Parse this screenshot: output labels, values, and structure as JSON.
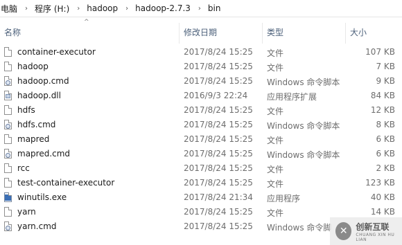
{
  "breadcrumb": [
    "电脑",
    "程序 (H:)",
    "hadoop",
    "hadoop-2.7.3",
    "bin"
  ],
  "columns": {
    "name": "名称",
    "modified": "修改日期",
    "type": "类型",
    "size": "大小"
  },
  "files": [
    {
      "name": "container-executor",
      "date": "2017/8/24 15:25",
      "type": "文件",
      "size": "107 KB",
      "icon": "file-icon"
    },
    {
      "name": "hadoop",
      "date": "2017/8/24 15:25",
      "type": "文件",
      "size": "7 KB",
      "icon": "file-icon"
    },
    {
      "name": "hadoop.cmd",
      "date": "2017/8/24 15:25",
      "type": "Windows 命令脚本",
      "size": "9 KB",
      "icon": "cmd-script-icon"
    },
    {
      "name": "hadoop.dll",
      "date": "2016/9/3 22:24",
      "type": "应用程序扩展",
      "size": "84 KB",
      "icon": "dll-icon"
    },
    {
      "name": "hdfs",
      "date": "2017/8/24 15:25",
      "type": "文件",
      "size": "12 KB",
      "icon": "file-icon"
    },
    {
      "name": "hdfs.cmd",
      "date": "2017/8/24 15:25",
      "type": "Windows 命令脚本",
      "size": "8 KB",
      "icon": "cmd-script-icon"
    },
    {
      "name": "mapred",
      "date": "2017/8/24 15:25",
      "type": "文件",
      "size": "6 KB",
      "icon": "file-icon"
    },
    {
      "name": "mapred.cmd",
      "date": "2017/8/24 15:25",
      "type": "Windows 命令脚本",
      "size": "6 KB",
      "icon": "cmd-script-icon"
    },
    {
      "name": "rcc",
      "date": "2017/8/24 15:25",
      "type": "文件",
      "size": "2 KB",
      "icon": "file-icon"
    },
    {
      "name": "test-container-executor",
      "date": "2017/8/24 15:25",
      "type": "文件",
      "size": "123 KB",
      "icon": "file-icon"
    },
    {
      "name": "winutils.exe",
      "date": "2017/8/24 21:34",
      "type": "应用程序",
      "size": "40 KB",
      "icon": "exe-icon"
    },
    {
      "name": "yarn",
      "date": "2017/8/24 15:25",
      "type": "文件",
      "size": "14 KB",
      "icon": "file-icon"
    },
    {
      "name": "yarn.cmd",
      "date": "2017/8/24 15:25",
      "type": "Windows 命令脚",
      "size": "",
      "icon": "cmd-script-icon"
    }
  ],
  "watermark": {
    "cn": "创新互联",
    "en": "CHUANG XIN HU LIAN"
  }
}
